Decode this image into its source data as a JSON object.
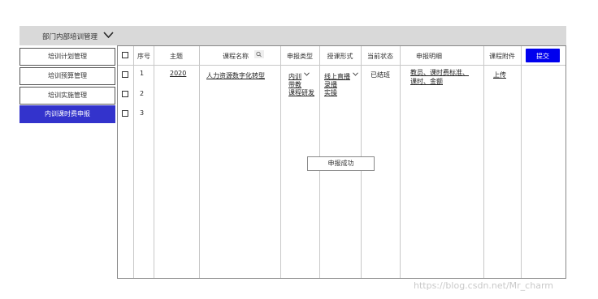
{
  "header": {
    "title": "部门内部培训管理"
  },
  "sidebar": {
    "items": [
      {
        "label": "培训计划管理"
      },
      {
        "label": "培训预算管理"
      },
      {
        "label": "培训实施管理"
      },
      {
        "label": "内训课时费申报"
      }
    ]
  },
  "table": {
    "columns": [
      "序号",
      "主题",
      "课程名称",
      "申报类型",
      "授课形式",
      "当前状态",
      "申报明细",
      "课程附件"
    ],
    "rows": [
      {
        "index": "1",
        "topic": "2020",
        "course": "人力资源数字化转型",
        "type_selected": "内训",
        "type_options": [
          "带教",
          "课程研发"
        ],
        "form_selected": "线上直播",
        "form_options": [
          "录播",
          "实操"
        ],
        "status": "已结班",
        "detail_line1": "教员、课时费标准、",
        "detail_line2": "课时、金额",
        "attachment": "上传"
      },
      {
        "index": "2"
      },
      {
        "index": "3"
      }
    ]
  },
  "actions": {
    "submit_label": "提交"
  },
  "toast": {
    "message": "申报成功"
  },
  "watermark": "https://blog.csdn.net/Mr_charm"
}
